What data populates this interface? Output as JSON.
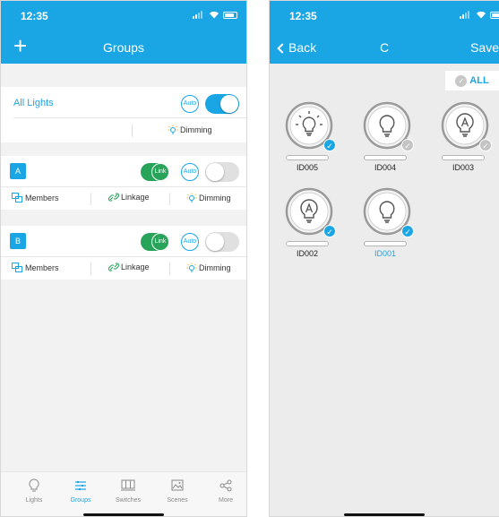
{
  "left": {
    "status": {
      "time": "12:35"
    },
    "nav": {
      "title": "Groups",
      "plus": "+"
    },
    "all_lights": {
      "label": "All Lights",
      "auto": "Auto",
      "dimming": "Dimming",
      "power_on": true
    },
    "groups": [
      {
        "badge": "A",
        "link": "Link",
        "auto": "Auto",
        "members": "Members",
        "linkage": "Linkage",
        "dimming": "Dimming",
        "power_on": false
      },
      {
        "badge": "B",
        "link": "Link",
        "auto": "Auto",
        "members": "Members",
        "linkage": "Linkage",
        "dimming": "Dimming",
        "power_on": false
      }
    ],
    "tabs": [
      {
        "label": "Lights",
        "icon": "bulb-icon",
        "active": false
      },
      {
        "label": "Groups",
        "icon": "groups-icon",
        "active": true
      },
      {
        "label": "Switches",
        "icon": "switch-panel-icon",
        "active": false
      },
      {
        "label": "Scenes",
        "icon": "scene-image-icon",
        "active": false
      },
      {
        "label": "More",
        "icon": "share-nodes-icon",
        "active": false
      }
    ]
  },
  "right": {
    "status": {
      "time": "12:35"
    },
    "nav": {
      "back": "Back",
      "title": "C",
      "save": "Save"
    },
    "all_button": {
      "label": "ALL",
      "checked": false
    },
    "devices": [
      {
        "id": "ID005",
        "type": "bulb-on",
        "selected": true,
        "checked": true
      },
      {
        "id": "ID004",
        "type": "bulb",
        "selected": false,
        "checked": false
      },
      {
        "id": "ID003",
        "type": "bulb-auto",
        "selected": false,
        "checked": false
      },
      {
        "id": "ID002",
        "type": "bulb-auto",
        "selected": false,
        "checked": true
      },
      {
        "id": "ID001",
        "type": "bulb",
        "selected": true,
        "checked": true
      }
    ]
  },
  "colors": {
    "accent": "#1aa6e4",
    "link_green": "#27a35a",
    "background": "#f2f2f2"
  }
}
